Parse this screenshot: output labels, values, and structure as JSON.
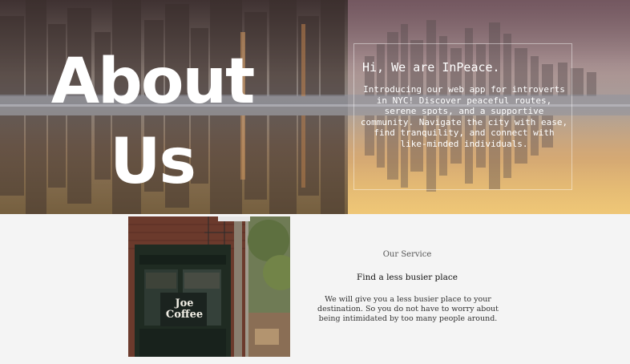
{
  "hero": {
    "title": "About Us",
    "intro": {
      "heading": "Hi, We are InPeace.",
      "text": "Introducing our web app for introverts in NYC! Discover peaceful routes, serene spots, and a supportive community. Navigate the city with ease, find tranquility, and connect with like-minded individuals."
    }
  },
  "service": {
    "label": "Our Service",
    "title": "Find a less busier place",
    "description": "We will give you a less busier place to your destination. So you do not have to worry about being intimidated by too many people around.",
    "photo_sign": "Joe Coffee"
  }
}
